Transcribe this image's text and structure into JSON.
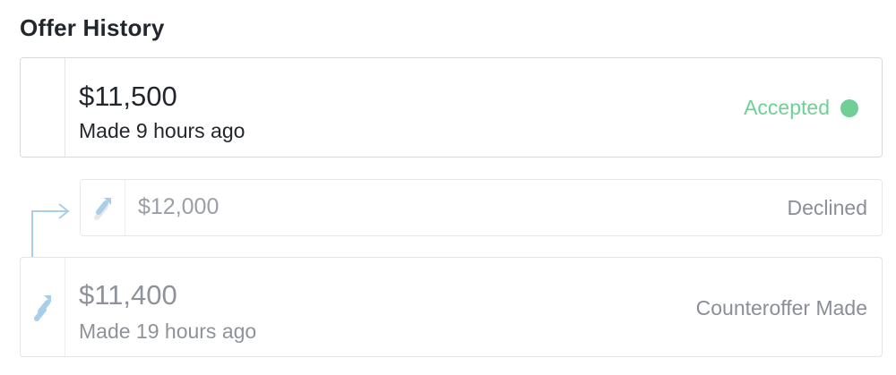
{
  "header": {
    "title": "Offer History"
  },
  "offers": [
    {
      "amount": "$11,500",
      "meta": "Made 9 hours ago",
      "status": "Accepted",
      "status_color": "#6fcf97"
    },
    {
      "amount": "$12,000",
      "meta": "",
      "status": "Declined",
      "icon": "counteroffer-arrow-icon"
    },
    {
      "amount": "$11,400",
      "meta": "Made 19 hours ago",
      "status": "Counteroffer Made",
      "icon": "counteroffer-arrow-icon"
    }
  ],
  "colors": {
    "accepted": "#6fcf97",
    "connector": "#a9cfe8",
    "muted_text": "#8e939a"
  }
}
